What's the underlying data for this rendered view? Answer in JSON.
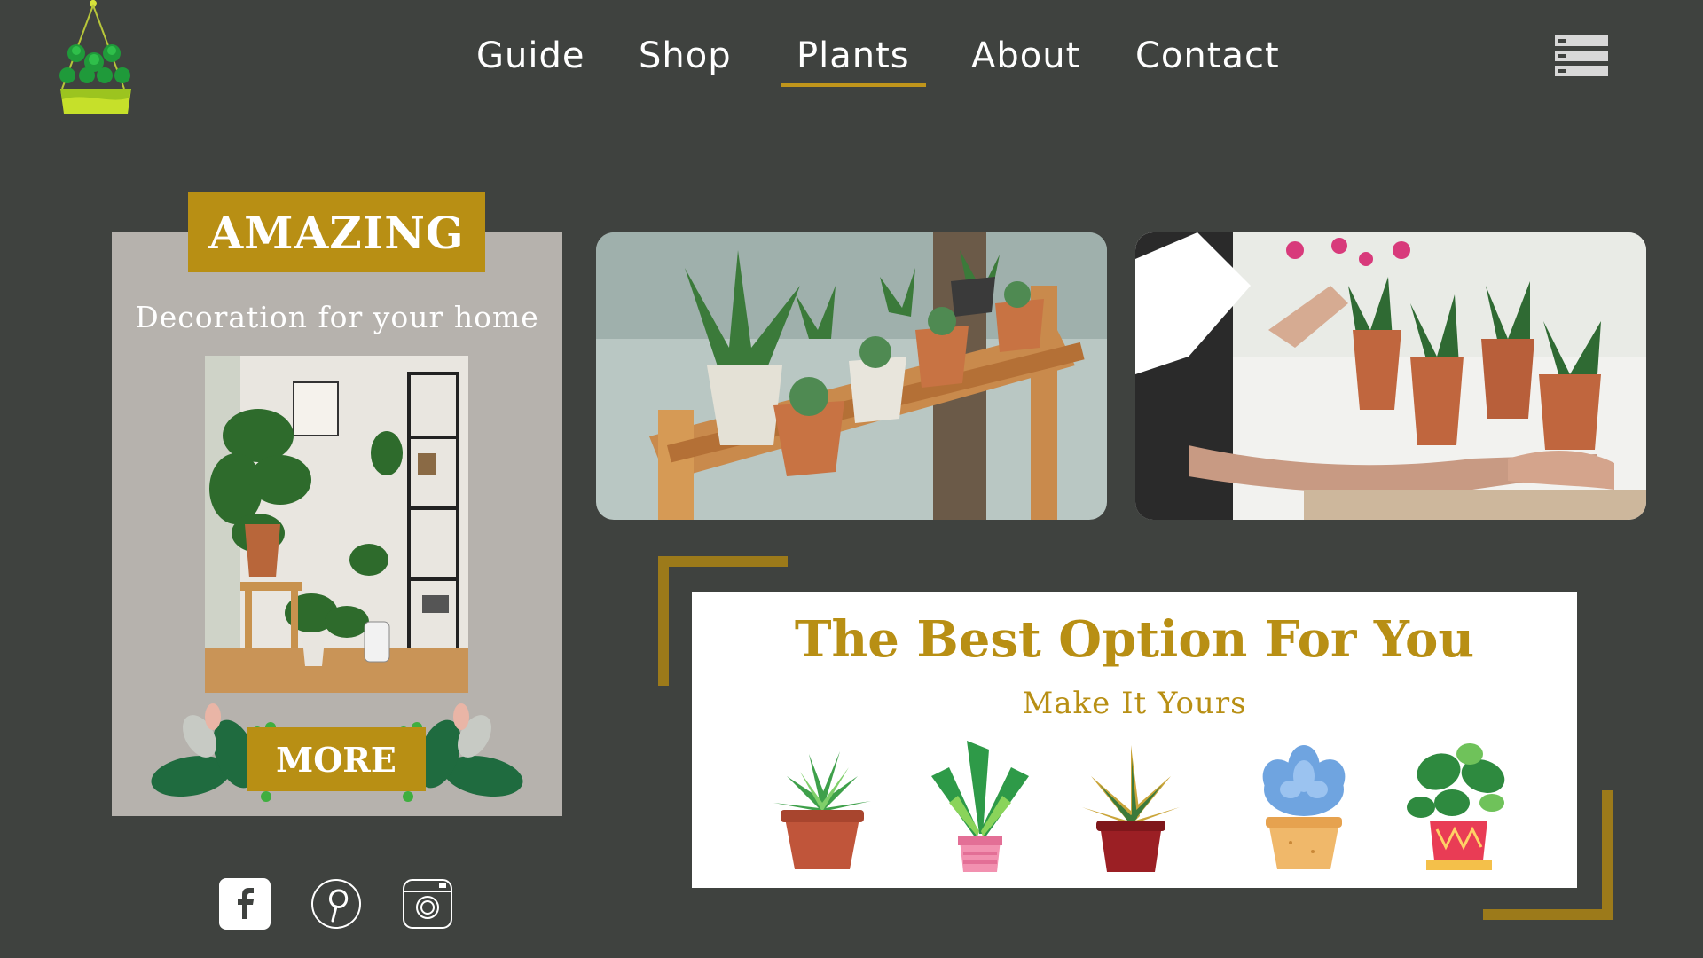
{
  "brand": {
    "logo_icon": "hanging-plant-icon"
  },
  "nav": {
    "items": [
      {
        "label": "Guide",
        "active": false
      },
      {
        "label": "Shop",
        "active": false
      },
      {
        "label": "Plants",
        "active": true
      },
      {
        "label": "About",
        "active": false
      },
      {
        "label": "Contact",
        "active": false
      }
    ],
    "menu_icon": "menu-list-icon"
  },
  "promo": {
    "badge": "AMAZING",
    "subtitle": "Decoration for your home",
    "button_label": "MORE"
  },
  "feature": {
    "title": "The Best Option For You",
    "subtitle": "Make It Yours",
    "plants": [
      "fern-pot-icon",
      "banana-plant-icon",
      "snake-plant-icon",
      "succulent-icon",
      "monstera-pot-icon"
    ]
  },
  "social": [
    "facebook-icon",
    "pinterest-icon",
    "instagram-icon"
  ],
  "colors": {
    "background": "#3f423f",
    "accent": "#b88f14",
    "card": "#b6b2ad"
  }
}
